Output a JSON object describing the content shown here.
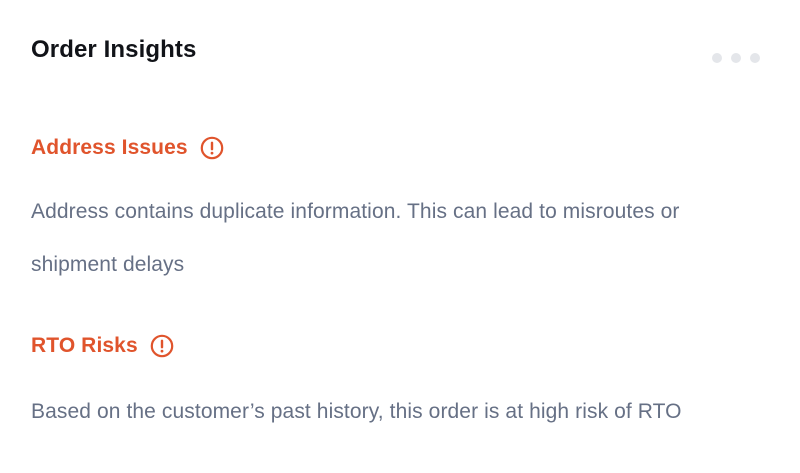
{
  "card": {
    "title": "Order Insights",
    "menu_icon": "more-horizontal-icon"
  },
  "sections": [
    {
      "title": "Address Issues",
      "icon": "alert-circle-icon",
      "text": "Address contains duplicate information. This can lead to misroutes or shipment delays"
    },
    {
      "title": "RTO Risks",
      "icon": "alert-circle-icon",
      "text": "Based on the customer’s past history, this order is at high risk of RTO"
    }
  ],
  "colors": {
    "title": "#111318",
    "warning": "#e0542c",
    "body_text": "#667085",
    "menu_dots": "#e4e6ea"
  }
}
